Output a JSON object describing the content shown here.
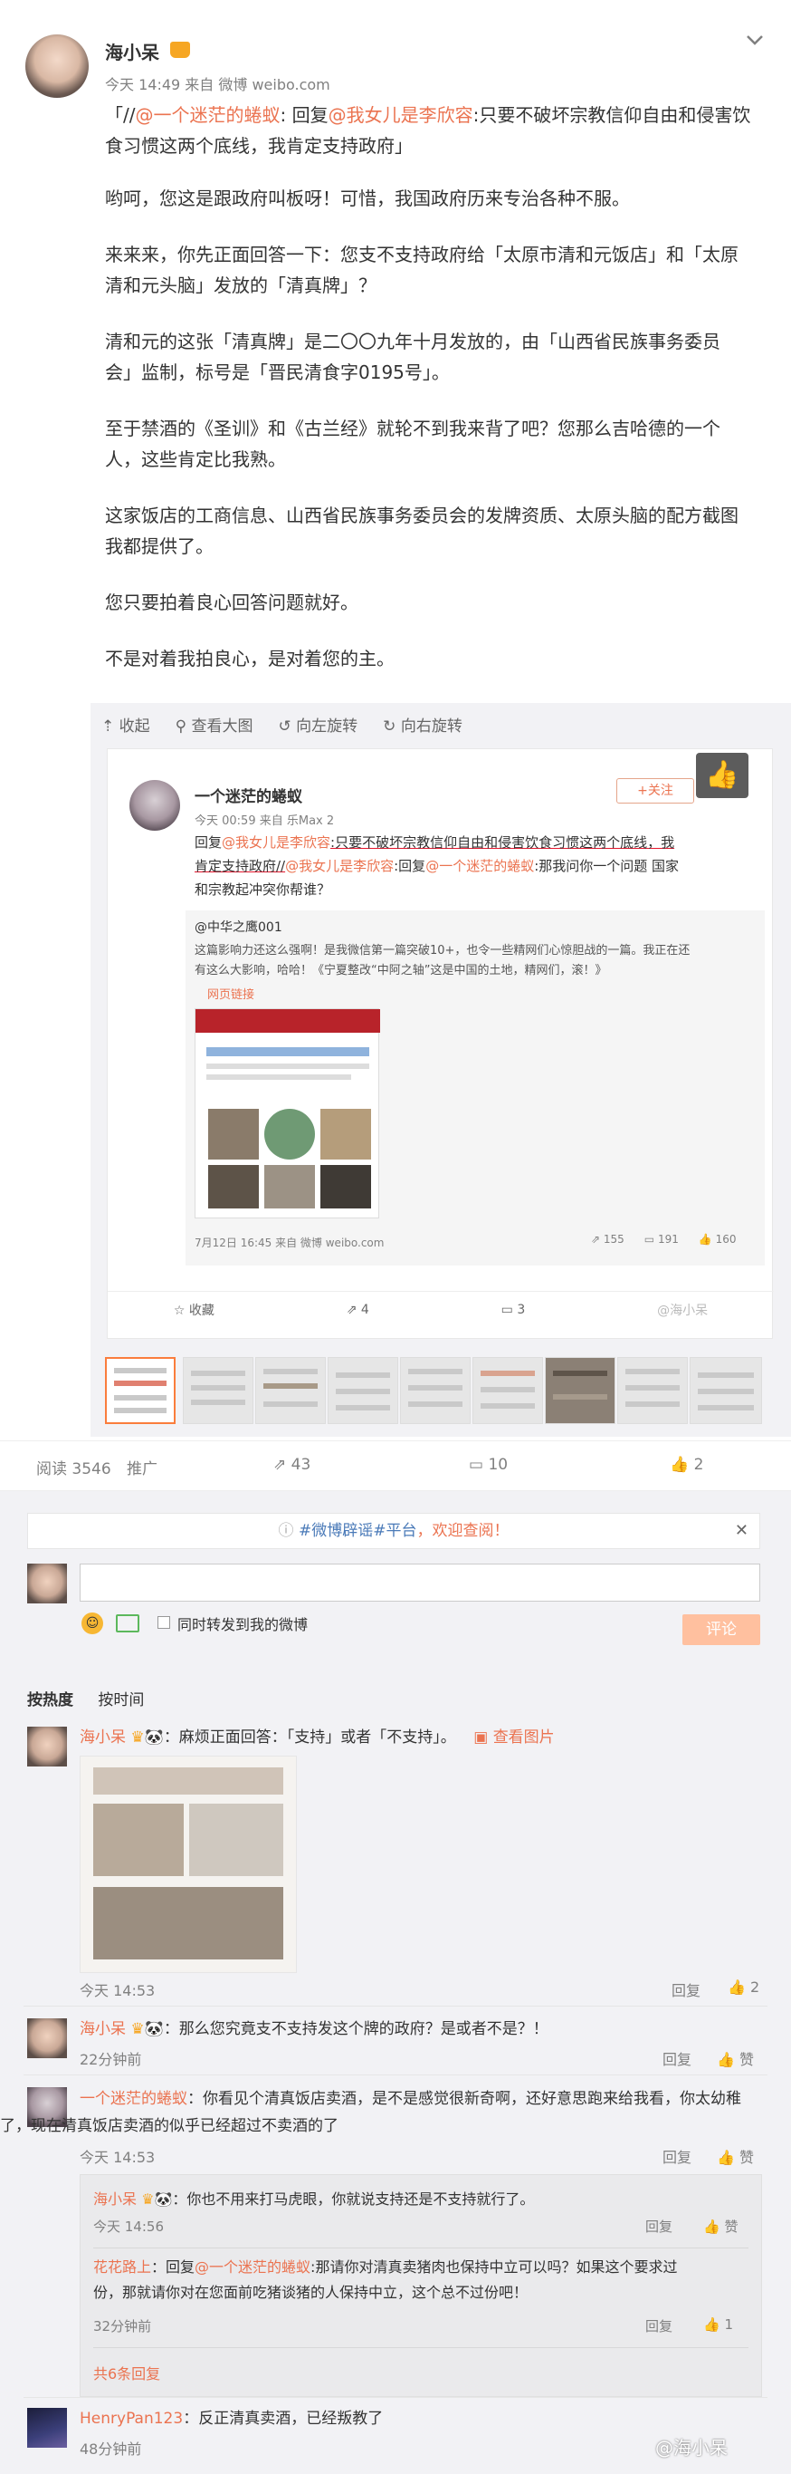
{
  "post": {
    "author": "海小呆",
    "meta": "今天 14:49 来自 微博 weibo.com",
    "quote_prefix": "「//",
    "quote_user1": "@一个迷茫的蜷蚁",
    "quote_mid": ": 回复",
    "quote_user2": "@我女儿是李欣容",
    "quote_text1": ":只要不破坏宗教信仰自由和侵害饮",
    "quote_text2": "食习惯这两个底线，我肯定支持政府」",
    "paragraphs": [
      [
        "哟呵，您这是跟政府叫板呀！可惜，我国政府历来专治各种不服。"
      ],
      [
        "来来来，你先正面回答一下：您支不支持政府给「太原市清和元饭店」和「太原",
        "清和元头脑」发放的「清真牌」？"
      ],
      [
        "清和元的这张「清真牌」是二〇〇九年十月发放的，由「山西省民族事务委员",
        "会」监制，标号是「晋民清食字0195号」。"
      ],
      [
        "至于禁酒的《圣训》和《古兰经》就轮不到我来背了吧？您那么吉哈德的一个",
        "人，这些肯定比我熟。"
      ],
      [
        "这家饭店的工商信息、山西省民族事务委员会的发牌资质、太原头脑的配方截图",
        "我都提供了。"
      ],
      [
        "您只要拍着良心回答问题就好。"
      ],
      [
        "不是对着我拍良心，是对着您的主。"
      ]
    ]
  },
  "image_toolbar": {
    "collapse": "收起",
    "view_large": "查看大图",
    "rotate_left": "向左旋转",
    "rotate_right": "向右旋转"
  },
  "screenshot": {
    "author": "一个迷茫的蜷蚁",
    "follow": "+关注",
    "meta": "今天 00:59 来自 乐Max 2",
    "reply_label": "回复",
    "reply_user1": "@我女儿是李欣容",
    "reply_text1": ":只要不破坏宗教信仰自由和侵害饮食习惯这两个底线，我",
    "reply_text2": "肯定支持政府//",
    "reply_user2": "@我女儿是李欣容",
    "reply_mid": ":回复",
    "reply_user3": "@一个迷茫的蜷蚁",
    "reply_text3": ":那我问你一个问题 国家",
    "reply_text4": "和宗教起冲突你帮谁？",
    "repost_user": "@中华之鹰001",
    "repost_line1": "这篇影响力还这么强啊！是我微信第一篇突破10+，也令一些精网们心惊胆战的一篇。我正在还",
    "repost_line2": "有这么大影响，哈哈！《宁夏整改“中阿之轴”这是中国的土地，精网们，滚！》",
    "web_link": "网页链接",
    "inner_time": "7月12日 16:45 来自 微博 weibo.com",
    "inner_reposts": "155",
    "inner_comments": "191",
    "inner_likes": "160",
    "bottom_fav": "收藏",
    "bottom_repost": "4",
    "bottom_comment": "3",
    "watermark": "@海小呆"
  },
  "stats": {
    "reads": "阅读 3546",
    "promote": "推广",
    "reposts": "43",
    "comments": "10",
    "likes": "2"
  },
  "notice": {
    "tag": "#微博辟谣#平台",
    "text": "，欢迎查阅！"
  },
  "composer": {
    "placeholder": "",
    "checkbox_label": "同时转发到我的微博",
    "submit": "评论"
  },
  "sort": {
    "hot": "按热度",
    "time": "按时间"
  },
  "comments": [
    {
      "user": "海小呆",
      "text": "：麻烦正面回答：「支持」或者「不支持」。",
      "extra": "查看图片",
      "time": "今天 14:53",
      "reply": "回复",
      "like": "2"
    },
    {
      "user": "海小呆",
      "text": "：那么您究竟支不支持发这个牌的政府？是或者不是？！",
      "time": "22分钟前",
      "reply": "回复",
      "like": "赞"
    },
    {
      "user": "一个迷茫的蜷蚁",
      "text1": "：你看见个清真饭店卖酒，是不是感觉很新奇啊，还好意思跑来给我看，你太幼稚",
      "text2": "了，现在清真饭店卖酒的似乎已经超过不卖酒的了",
      "time": "今天 14:53",
      "reply": "回复",
      "like": "赞"
    },
    {
      "user": "HenryPan123",
      "text": "：反正清真卖酒，已经叛教了",
      "time": "48分钟前"
    }
  ],
  "subreplies": [
    {
      "user": "海小呆",
      "text": "：你也不用来打马虎眼，你就说支持还是不支持就行了。",
      "time": "今天 14:56",
      "reply": "回复",
      "like": "赞"
    },
    {
      "user": "花花路上",
      "mid": "：回复",
      "mention": "@一个迷茫的蜷蚁",
      "text1": ":那请你对清真卖猪肉也保持中立可以吗？如果这个要求过",
      "text2": "份，那就请你对在您面前吃猪谈猪的人保持中立，这个总不过份吧！",
      "time": "32分钟前",
      "reply": "回复",
      "like": "1"
    }
  ],
  "more_replies": "共6条回复",
  "footer_watermark": "@海小呆",
  "colors": {
    "link": "#eb7350",
    "accent_orange": "#fa7d3c",
    "weibo_red": "#e6162d"
  }
}
